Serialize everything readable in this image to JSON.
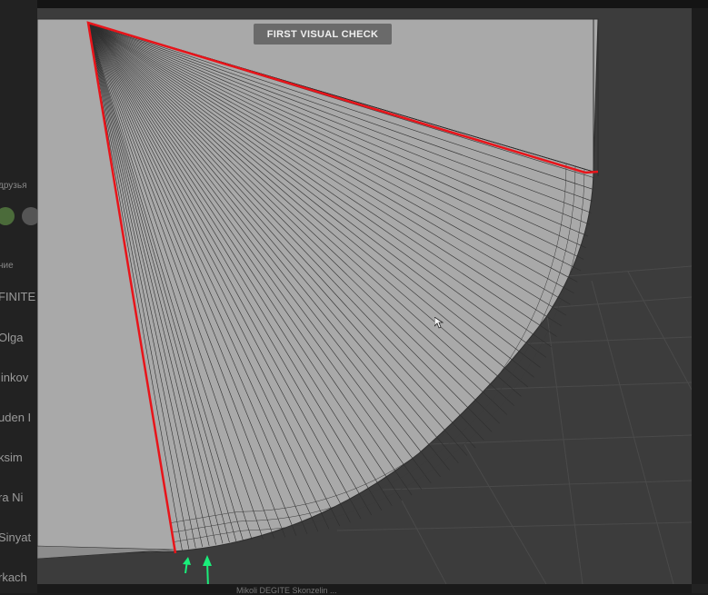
{
  "badge": {
    "label": "FIRST VISUAL CHECK"
  },
  "background_sidebar": {
    "header": "друзья",
    "section": "ние",
    "items": [
      "FINITE",
      "Olga",
      "linkov",
      "uden I",
      "ksim",
      "ra Ni",
      "Sinyat",
      "rkach"
    ]
  },
  "bottom_caption": "Mikoli DEGITE Skonzelin ...",
  "colors": {
    "viewport_bg": "#3c3c3c",
    "mesh_fill": "#a9a9a9",
    "wire": "#2e2e2e",
    "highlight_red": "#e8141a",
    "arrow_green": "#1aee7a"
  },
  "icons": [
    "mouse-cursor-icon",
    "arrow-up-icon"
  ]
}
